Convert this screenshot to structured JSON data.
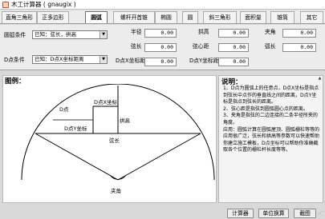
{
  "window": {
    "title": "木工计算器  ( gnaugix )"
  },
  "tabs": [
    {
      "label": "直角三角形"
    },
    {
      "label": "正多边形"
    },
    {
      "label": "圆弧"
    },
    {
      "label": "螺杆开首锥"
    },
    {
      "label": "椭圆"
    },
    {
      "label": "圆"
    },
    {
      "label": "斜三角形"
    },
    {
      "label": "面积量"
    },
    {
      "label": "锥筒"
    },
    {
      "label": "其它"
    }
  ],
  "active_tab": "圆弧",
  "form": {
    "condition_label": "圆弧条件",
    "condition_value": "已知：弦长，拱高",
    "d_condition_label": "D点条件",
    "d_condition_value": "已知：D点X坐标距离",
    "radius_label": "半径",
    "radius_value": "0.00",
    "arch_height_label": "拱高",
    "arch_height_value": "0.00",
    "angle_label": "夹角",
    "angle_value": "0.00",
    "chord_label": "弦长",
    "chord_value": "0.00",
    "chord_center_label": "弦心距",
    "chord_center_value": "0.00",
    "arc_length_label": "弧长",
    "arc_length_value": "0.00",
    "dx_label": "D点X坐标距",
    "dx_value": "0.00",
    "dy_label": "D点Y坐标距",
    "dy_value": "0.00"
  },
  "figure": {
    "title": "图例：",
    "labels": {
      "d_point": "D点",
      "d_x": "D点X坐标",
      "d_y": "D点Y坐标",
      "arch": "拱高",
      "chord": "弦长",
      "angle": "夹角"
    }
  },
  "notes": {
    "title": "说明：",
    "text": "1、D点为圆弧上的任意点，D点X坐标是指点到弦长中点作的垂直线之间的距离，D点Y坐标是指点到弦长的距离。\n2、弦心距是指弦到圆弧圆心点的距离。\n3、夹角是指弦的二边连接的二条半径所夹的角度。\n应用：圆弧计算在圆弧屋顶、圆弧栅栏等等的应用很广泛，弦长和拱高等参数可以快速帮助你建立施工模板，D点坐标可以帮助你准确截取各个位置的栅栏杆长度等等。"
  },
  "buttons": {
    "calculator": "计算器",
    "unit_convert": "单位换算",
    "screenshot": "截图"
  }
}
